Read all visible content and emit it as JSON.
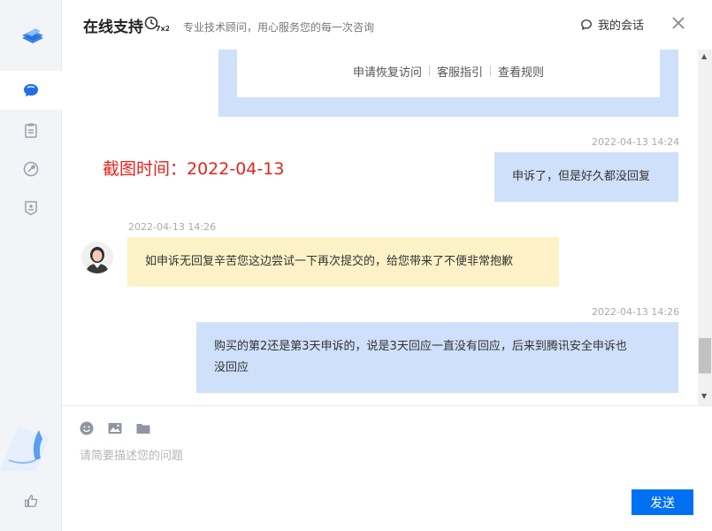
{
  "header": {
    "title": "在线支持",
    "badge": "7x24",
    "subtitle": "专业技术顾问，用心服务您的每一次咨询",
    "my_sessions": "我的会话"
  },
  "card": {
    "links": [
      "申请恢复访问",
      "客服指引",
      "查看规则"
    ]
  },
  "watermark": "截图时间：2022-04-13",
  "messages": [
    {
      "role": "user",
      "time": "2022-04-13 14:24",
      "text": "申诉了，但是好久都没回复"
    },
    {
      "role": "agent",
      "time": "2022-04-13 14:26",
      "text": "如申诉无回复辛苦您这边尝试一下再次提交的，给您带来了不便非常抱歉"
    },
    {
      "role": "user",
      "time": "2022-04-13 14:26",
      "text_line1": "购买的第2还是第3天申诉的，说是3天回应一直没有回应，后来到腾讯安全申诉也",
      "text_line2": "没回应"
    }
  ],
  "input": {
    "placeholder": "请简要描述您的问题"
  },
  "send_label": "发送",
  "colors": {
    "accent": "#0070f3",
    "user_bubble": "#cfe0fa",
    "agent_bubble": "#fdf2c7",
    "watermark": "#e8231c"
  },
  "icons": {
    "sidebar": [
      "chat-icon",
      "clipboard-icon",
      "wrench-icon",
      "badge-icon"
    ],
    "tools": [
      "emoji-icon",
      "image-icon",
      "folder-icon"
    ]
  }
}
